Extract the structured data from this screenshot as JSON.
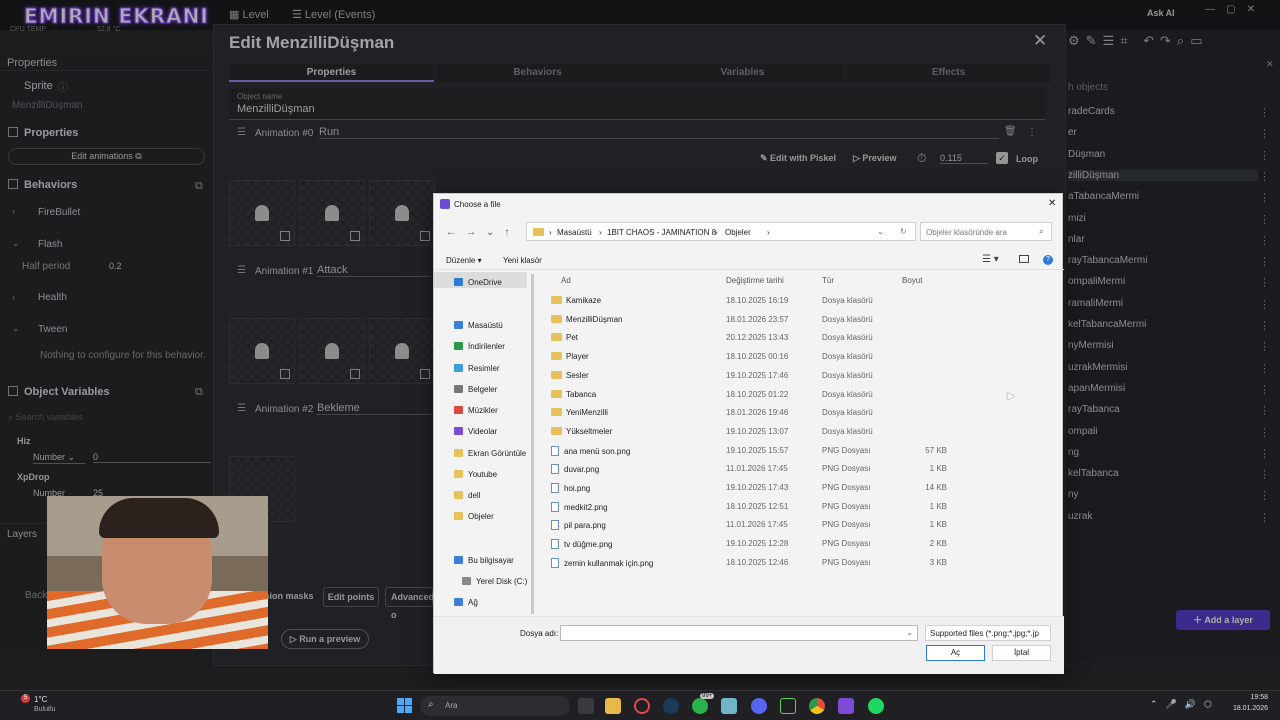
{
  "overlay_title": "EMIRIN EKRANI",
  "system": {
    "cpu_label": "CPU TEMP",
    "cpu_value": "52.8 °C",
    "ask_ai": "Ask AI"
  },
  "top_tabs": [
    "Level",
    "Level (Events)"
  ],
  "left_panel": {
    "properties_title": "Properties",
    "sprite_label": "Sprite",
    "sprite_value": "MenzilliDüşman",
    "properties_section": "Properties",
    "edit_animations": "Edit animations",
    "behaviors_section": "Behaviors",
    "behaviors": [
      "FireBullet",
      "Flash",
      "Health",
      "Tween"
    ],
    "half_period_label": "Half period",
    "half_period_value": "0.2",
    "tween_note": "Nothing to configure for this behavior.",
    "object_variables_section": "Object Variables",
    "search_variables_placeholder": "Search variables",
    "variables": [
      {
        "name": "Hiz",
        "type": "Number",
        "value": "0"
      },
      {
        "name": "XpDrop",
        "type": "Number",
        "value": "25"
      }
    ],
    "layers_title": "Layers",
    "background_label": "Back"
  },
  "right_panel": {
    "search_placeholder": "h objects",
    "objects": [
      "radeCards",
      "er",
      "Düşman",
      "zilliDüşman",
      "aTabancaMermi",
      "mizi",
      "nlar",
      "rayTabancaMermi",
      "ompaliMermi",
      "ramaliMermi",
      "kelTabancaMermi",
      "nyMermisi",
      "uzrakMermisi",
      "apanMermisi",
      "rayTabanca",
      "ompali",
      "ng",
      "kelTabanca",
      "ny",
      "uzrak"
    ],
    "add_layer": "Add a layer"
  },
  "edit_dialog": {
    "title": "Edit MenzilliDüşman",
    "tabs": [
      "Properties",
      "Behaviors",
      "Variables",
      "Effects"
    ],
    "object_name_label": "Object name",
    "object_name_value": "MenzilliDüşman",
    "animations": [
      {
        "label": "Animation #0",
        "name": "Run"
      },
      {
        "label": "Animation #1",
        "name": "Attack"
      },
      {
        "label": "Animation #2",
        "name": "Bekleme"
      }
    ],
    "edit_with_piskel": "Edit with Piskel",
    "preview": "Preview",
    "timing": "0.115",
    "loop": "Loop",
    "collision_masks": "ision masks",
    "edit_points": "Edit points",
    "advanced": "Advanced o",
    "run_preview": "Run a preview"
  },
  "file_dialog": {
    "title": "Choose a file",
    "breadcrumb": [
      "Masaüstü",
      "1BIT CHAOS - JAMINATION 8",
      "Objeler"
    ],
    "search_placeholder": "Objeler klasöründe ara",
    "organize": "Düzenle",
    "new_folder": "Yeni klasör",
    "columns": [
      "Ad",
      "Değiştirme tarihi",
      "Tür",
      "Boyut"
    ],
    "sidebar": [
      "OneDrive",
      "Masaüstü",
      "İndirilenler",
      "Resimler",
      "Belgeler",
      "Müzikler",
      "Videolar",
      "Ekran Görüntüle",
      "Youtube",
      "dell",
      "Objeler",
      "Bu bilgisayar",
      "Yerel Disk (C:)",
      "Ağ"
    ],
    "files": [
      {
        "name": "Kamikaze",
        "date": "18.10.2025 16:19",
        "type": "Dosya klasörü",
        "size": "",
        "kind": "folder"
      },
      {
        "name": "MenzilliDüşman",
        "date": "18.01.2026 23:57",
        "type": "Dosya klasörü",
        "size": "",
        "kind": "folder"
      },
      {
        "name": "Pet",
        "date": "20.12.2025 13:43",
        "type": "Dosya klasörü",
        "size": "",
        "kind": "folder"
      },
      {
        "name": "Player",
        "date": "18.10.2025 00:16",
        "type": "Dosya klasörü",
        "size": "",
        "kind": "folder"
      },
      {
        "name": "Sesler",
        "date": "19.10.2025 17:46",
        "type": "Dosya klasörü",
        "size": "",
        "kind": "folder"
      },
      {
        "name": "Tabanca",
        "date": "18.10.2025 01:22",
        "type": "Dosya klasörü",
        "size": "",
        "kind": "folder"
      },
      {
        "name": "YeniMenzilli",
        "date": "18.01.2026 19:46",
        "type": "Dosya klasörü",
        "size": "",
        "kind": "folder"
      },
      {
        "name": "Yükseltmeler",
        "date": "19.10.2025 13:07",
        "type": "Dosya klasörü",
        "size": "",
        "kind": "folder"
      },
      {
        "name": "ana menü son.png",
        "date": "19.10.2025 15:57",
        "type": "PNG Dosyası",
        "size": "57 KB",
        "kind": "png"
      },
      {
        "name": "duvar.png",
        "date": "11.01.2026 17:45",
        "type": "PNG Dosyası",
        "size": "1 KB",
        "kind": "png"
      },
      {
        "name": "hoi.png",
        "date": "19.10.2025 17:43",
        "type": "PNG Dosyası",
        "size": "14 KB",
        "kind": "png"
      },
      {
        "name": "medkit2.png",
        "date": "18.10.2025 12:51",
        "type": "PNG Dosyası",
        "size": "1 KB",
        "kind": "png"
      },
      {
        "name": "pil para.png",
        "date": "11.01.2026 17:45",
        "type": "PNG Dosyası",
        "size": "1 KB",
        "kind": "png"
      },
      {
        "name": "tv düğme.png",
        "date": "19.10.2025 12:28",
        "type": "PNG Dosyası",
        "size": "2 KB",
        "kind": "png"
      },
      {
        "name": "zemin kullanmak için.png",
        "date": "18.10.2025 12:46",
        "type": "PNG Dosyası",
        "size": "3 KB",
        "kind": "png"
      }
    ],
    "filename_label": "Dosya adı:",
    "filetype": "Supported files (*.png;*.jpg;*.jp",
    "open": "Aç",
    "cancel": "İptal"
  },
  "taskbar": {
    "weather_temp": "1°C",
    "weather_text": "Bulutlu",
    "weather_badge": "5",
    "search": "Ara",
    "whatsapp_badge": "99+",
    "time": "19:58",
    "date": "18.01.2026"
  }
}
